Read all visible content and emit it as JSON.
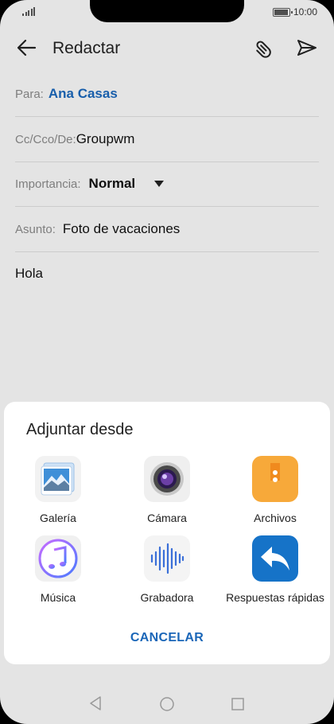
{
  "status_bar": {
    "time": "10:00"
  },
  "toolbar": {
    "title": "Redactar"
  },
  "compose": {
    "to_label": "Para:",
    "to_value": "Ana Casas",
    "cc_label": "Cc/Cco/De:",
    "cc_value": "Groupwm",
    "importance_label": "Importancia:",
    "importance_value": "Normal",
    "subject_label": "Asunto:",
    "subject_value": "Foto de vacaciones",
    "body": "Hola"
  },
  "attach_sheet": {
    "title": "Adjuntar desde",
    "options": [
      {
        "label": "Galería",
        "icon": "gallery-icon"
      },
      {
        "label": "Cámara",
        "icon": "camera-icon"
      },
      {
        "label": "Archivos",
        "icon": "files-icon"
      },
      {
        "label": "Música",
        "icon": "music-icon"
      },
      {
        "label": "Grabadora",
        "icon": "recorder-icon"
      },
      {
        "label": "Respuestas rápidas",
        "icon": "quick-replies-icon"
      }
    ],
    "cancel": "CANCELAR"
  },
  "colors": {
    "accent": "#1a66b8",
    "files_orange": "#f7a93a",
    "quick_reply_blue": "#1673c8"
  }
}
